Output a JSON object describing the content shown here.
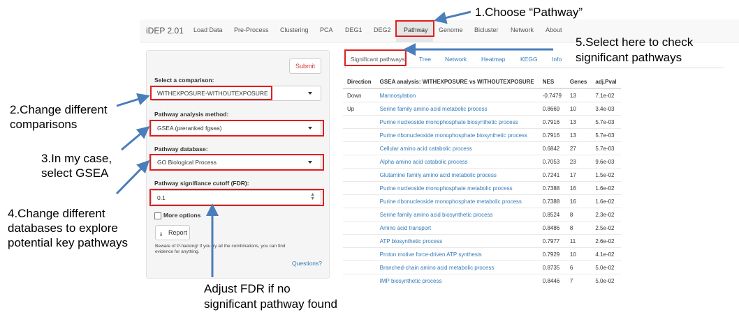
{
  "navbar": {
    "brand": "iDEP 2.01",
    "items": [
      "Load Data",
      "Pre-Process",
      "Clustering",
      "PCA",
      "DEG1",
      "DEG2",
      "Pathway",
      "Genome",
      "Bicluster",
      "Network",
      "About"
    ]
  },
  "sidebar": {
    "submit": "Submit",
    "comparison_label": "Select a comparison:",
    "comparison_value": "WITHEXPOSURE-WITHOUTEXPOSURE",
    "method_label": "Pathway analysis method:",
    "method_value": "GSEA (preranked fgsea)",
    "database_label": "Pathway database:",
    "database_value": "GO Biological Process",
    "fdr_label": "Pathway signifiance cutoff (FDR):",
    "fdr_value": "0.1",
    "more_options": "More options",
    "report": "Report",
    "warning_line1": "Beware of P-hacking! If you try all the combinations, you can find",
    "warning_line2": "evidence for anything.",
    "questions": "Questions?"
  },
  "tabs": [
    "Significant pathways",
    "Tree",
    "Network",
    "Heatmap",
    "KEGG",
    "Info"
  ],
  "table": {
    "headers": [
      "Direction",
      "GSEA analysis: WITHEXPOSURE vs WITHOUTEXPOSURE",
      "NES",
      "Genes",
      "adj.Pval"
    ],
    "rows": [
      [
        "Down",
        "Mannosylation",
        "-0.7479",
        "13",
        "7.1e-02"
      ],
      [
        "Up",
        "Serine family amino acid metabolic process",
        "0.8669",
        "10",
        "3.4e-03"
      ],
      [
        "",
        "Purine nucleoside monophosphate biosynthetic process",
        "0.7916",
        "13",
        "5.7e-03"
      ],
      [
        "",
        "Purine ribonucleoside monophosphate biosynthetic process",
        "0.7916",
        "13",
        "5.7e-03"
      ],
      [
        "",
        "Cellular amino acid catabolic process",
        "0.6842",
        "27",
        "5.7e-03"
      ],
      [
        "",
        "Alpha-amino acid catabolic process",
        "0.7053",
        "23",
        "9.6e-03"
      ],
      [
        "",
        "Glutamine family amino acid metabolic process",
        "0.7241",
        "17",
        "1.5e-02"
      ],
      [
        "",
        "Purine nucleoside monophosphate metabolic process",
        "0.7388",
        "16",
        "1.6e-02"
      ],
      [
        "",
        "Purine ribonucleoside monophosphate metabolic process",
        "0.7388",
        "16",
        "1.6e-02"
      ],
      [
        "",
        "Serine family amino acid biosynthetic process",
        "0.8524",
        "8",
        "2.3e-02"
      ],
      [
        "",
        "Amino acid transport",
        "0.8486",
        "8",
        "2.5e-02"
      ],
      [
        "",
        "ATP biosynthetic process",
        "0.7977",
        "11",
        "2.6e-02"
      ],
      [
        "",
        "Proton motive force-driven ATP synthesis",
        "0.7929",
        "10",
        "4.1e-02"
      ],
      [
        "",
        "Branched-chain amino acid metabolic process",
        "0.8735",
        "6",
        "5.0e-02"
      ],
      [
        "",
        "IMP biosynthetic process",
        "0.8446",
        "7",
        "5.0e-02"
      ]
    ]
  },
  "annotations": {
    "a1": "1.Choose “Pathway”",
    "a2_line1": "2.Change different",
    "a2_line2": "comparisons",
    "a3_line1": "3.In my case,",
    "a3_line2": "select GSEA",
    "a4_line1": "4.Change different",
    "a4_line2": "databases to explore",
    "a4_line3": "potential key pathways",
    "a5_line1": "5.Select here to check",
    "a5_line2": "significant pathways",
    "a6_line1": "Adjust FDR if no",
    "a6_line2": "significant pathway found"
  },
  "colors": {
    "highlight": "#e01e1e",
    "arrow": "#4a7ebb",
    "link": "#337ab7"
  }
}
